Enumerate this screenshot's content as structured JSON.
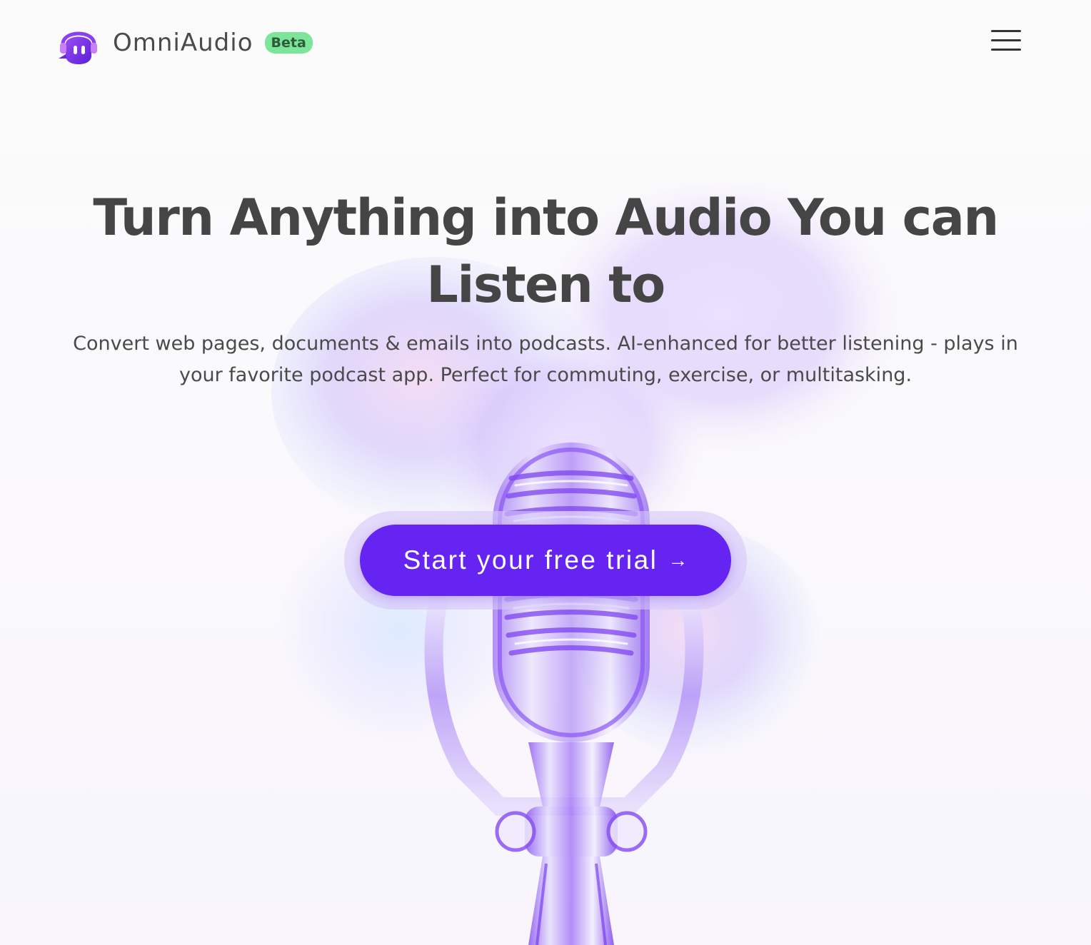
{
  "header": {
    "brand_name": "OmniAudio",
    "beta_label": "Beta",
    "logo_icon": "headphone-ghost-logo",
    "menu_icon": "hamburger-menu-icon"
  },
  "hero": {
    "title": "Turn Anything into Audio You can Listen to",
    "subtitle": "Convert web pages, documents & emails into podcasts. AI-enhanced for better listening - plays in your favorite podcast app. Perfect for commuting, exercise, or multitasking.",
    "cta_label": "Start your free trial",
    "cta_arrow": "→",
    "illustration": "microphone-illustration"
  },
  "colors": {
    "accent": "#6624f2",
    "cta_halo": "#d6c8fa",
    "beta_badge_bg": "#7be59a",
    "beta_badge_text": "#2f5a3a",
    "title_text": "#454545",
    "logo_purple": "#7a32e8"
  }
}
